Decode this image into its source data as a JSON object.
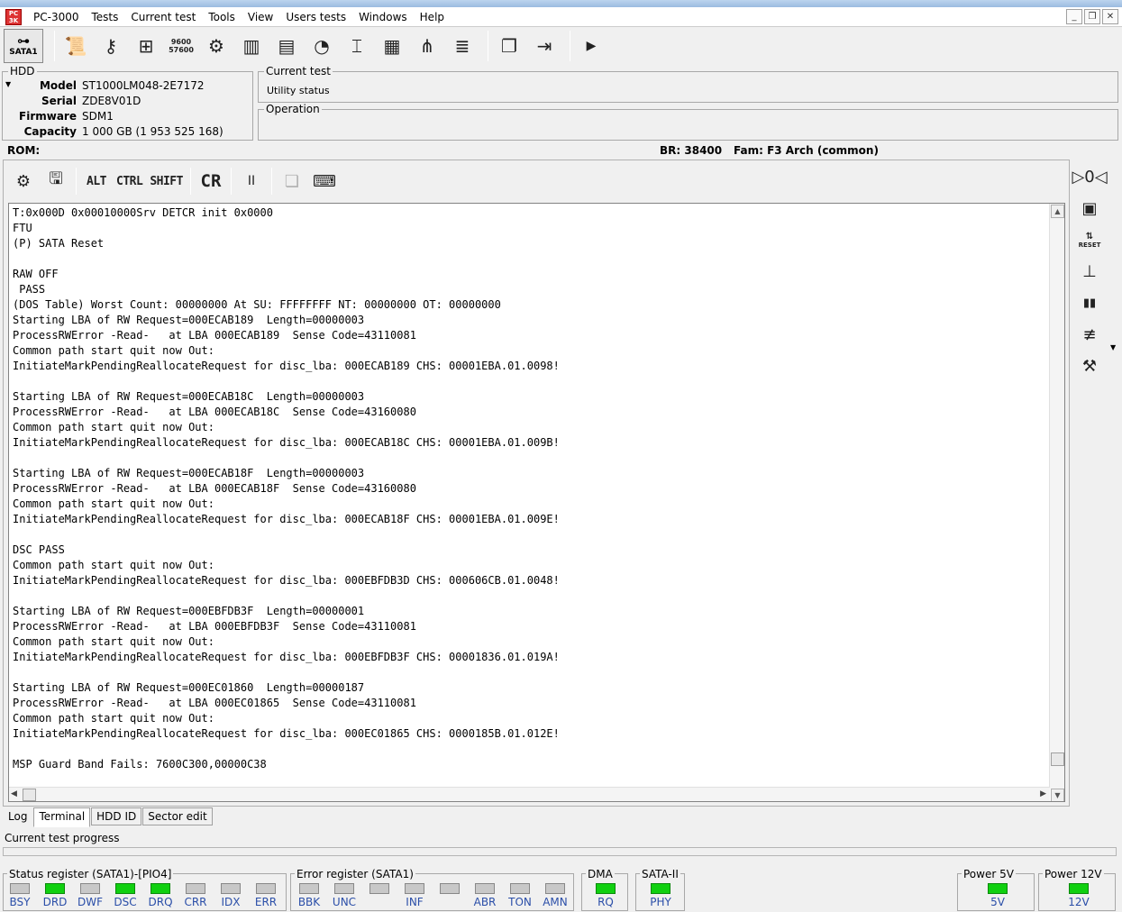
{
  "app": {
    "title": "PC-3000",
    "menu": [
      "Tests",
      "Current test",
      "Tools",
      "View",
      "Users tests",
      "Windows",
      "Help"
    ],
    "window_controls": {
      "minimize": "_",
      "restore": "❐",
      "close": "✕"
    }
  },
  "toolbar": {
    "port_label": "SATA1",
    "baud_top": "9600",
    "baud_bottom": "57600"
  },
  "hdd": {
    "group_title": "HDD",
    "fields": [
      {
        "key": "Model",
        "value": "ST1000LM048-2E7172"
      },
      {
        "key": "Serial",
        "value": "ZDE8V01D"
      },
      {
        "key": "Firmware",
        "value": "SDM1"
      },
      {
        "key": "Capacity",
        "value": "1 000 GB (1 953 525 168)"
      }
    ]
  },
  "current_test": {
    "title": "Current test",
    "value": "Utility status"
  },
  "operation": {
    "title": "Operation",
    "value": ""
  },
  "info_line": {
    "rom": "ROM:",
    "br": "BR: 38400",
    "fam": "Fam: F3 Arch (common)"
  },
  "terminal_toolbar": {
    "alt": "ALT",
    "ctrl": "CTRL",
    "shift": "SHIFT",
    "cr": "CR",
    "pause": "II"
  },
  "terminal": {
    "lines": [
      "T:0x000D 0x00010000Srv DETCR init 0x0000",
      "FTU",
      "(P) SATA Reset",
      "",
      "RAW OFF",
      " PASS",
      "(DOS Table) Worst Count: 00000000 At SU: FFFFFFFF NT: 00000000 OT: 00000000",
      "Starting LBA of RW Request=000ECAB189  Length=00000003",
      "ProcessRWError -Read-   at LBA 000ECAB189  Sense Code=43110081",
      "Common path start quit now Out:",
      "InitiateMarkPendingReallocateRequest for disc_lba: 000ECAB189 CHS: 00001EBA.01.0098!",
      "",
      "Starting LBA of RW Request=000ECAB18C  Length=00000003",
      "ProcessRWError -Read-   at LBA 000ECAB18C  Sense Code=43160080",
      "Common path start quit now Out:",
      "InitiateMarkPendingReallocateRequest for disc_lba: 000ECAB18C CHS: 00001EBA.01.009B!",
      "",
      "Starting LBA of RW Request=000ECAB18F  Length=00000003",
      "ProcessRWError -Read-   at LBA 000ECAB18F  Sense Code=43160080",
      "Common path start quit now Out:",
      "InitiateMarkPendingReallocateRequest for disc_lba: 000ECAB18F CHS: 00001EBA.01.009E!",
      "",
      "DSC PASS",
      "Common path start quit now Out:",
      "InitiateMarkPendingReallocateRequest for disc_lba: 000EBFDB3D CHS: 000606CB.01.0048!",
      "",
      "Starting LBA of RW Request=000EBFDB3F  Length=00000001",
      "ProcessRWError -Read-   at LBA 000EBFDB3F  Sense Code=43110081",
      "Common path start quit now Out:",
      "InitiateMarkPendingReallocateRequest for disc_lba: 000EBFDB3F CHS: 00001836.01.019A!",
      "",
      "Starting LBA of RW Request=000EC01860  Length=00000187",
      "ProcessRWError -Read-   at LBA 000EC01865  Sense Code=43110081",
      "Common path start quit now Out:",
      "InitiateMarkPendingReallocateRequest for disc_lba: 000EC01865 CHS: 0000185B.01.012E!",
      "",
      "MSP Guard Band Fails: 7600C300,00000C38"
    ]
  },
  "tabs": [
    {
      "label": "Log",
      "active": false
    },
    {
      "label": "Terminal",
      "active": true
    },
    {
      "label": "HDD ID",
      "active": false
    },
    {
      "label": "Sector edit",
      "active": false
    }
  ],
  "progress": {
    "label": "Current test progress",
    "value": 0
  },
  "status_register": {
    "title": "Status register (SATA1)-[PIO4]",
    "leds": [
      {
        "label": "BSY",
        "on": false
      },
      {
        "label": "DRD",
        "on": true
      },
      {
        "label": "DWF",
        "on": false
      },
      {
        "label": "DSC",
        "on": true
      },
      {
        "label": "DRQ",
        "on": true
      },
      {
        "label": "CRR",
        "on": false
      },
      {
        "label": "IDX",
        "on": false
      },
      {
        "label": "ERR",
        "on": false
      }
    ]
  },
  "error_register": {
    "title": "Error register (SATA1)",
    "leds": [
      {
        "label": "BBK",
        "on": false
      },
      {
        "label": "UNC",
        "on": false
      },
      {
        "label": "",
        "on": false
      },
      {
        "label": "INF",
        "on": false
      },
      {
        "label": "",
        "on": false
      },
      {
        "label": "ABR",
        "on": false
      },
      {
        "label": "TON",
        "on": false
      },
      {
        "label": "AMN",
        "on": false
      }
    ]
  },
  "dma": {
    "title": "DMA",
    "led": {
      "label": "RQ",
      "on": true
    }
  },
  "sata2": {
    "title": "SATA-II",
    "led": {
      "label": "PHY",
      "on": true
    }
  },
  "power5": {
    "title": "Power 5V",
    "led": {
      "label": "5V",
      "on": true
    }
  },
  "power12": {
    "title": "Power 12V",
    "led": {
      "label": "12V",
      "on": true
    }
  },
  "colors": {
    "led_on": "#10d010",
    "led_off": "#c8c8c8",
    "led_label": "#2a4ea8",
    "app_icon": "#dd3333"
  }
}
